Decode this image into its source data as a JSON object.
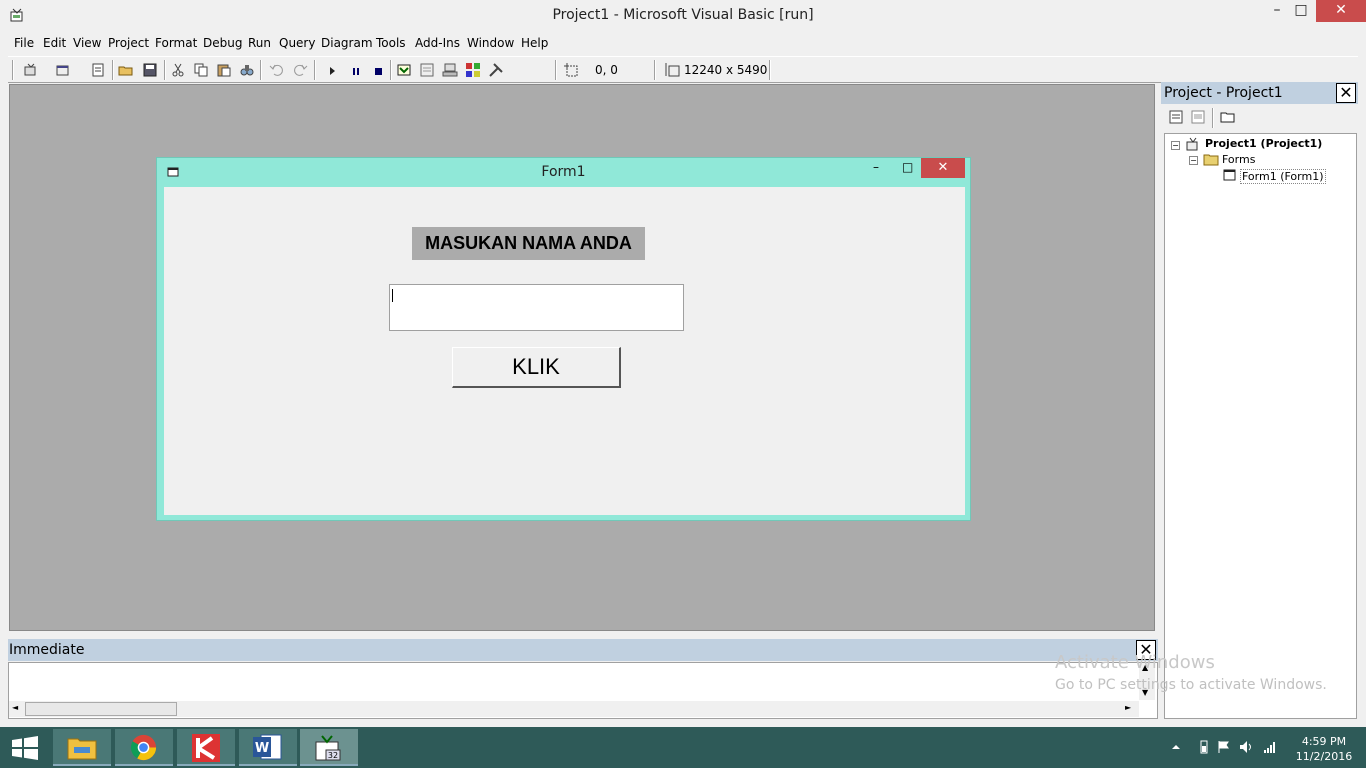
{
  "window": {
    "title": "Project1 - Microsoft Visual Basic [run]",
    "min_glyph": "–",
    "max_glyph": "□",
    "close_glyph": "✕"
  },
  "menu": [
    "File",
    "Edit",
    "View",
    "Project",
    "Format",
    "Debug",
    "Run",
    "Query",
    "Diagram",
    "Tools",
    "Add-Ins",
    "Window",
    "Help"
  ],
  "toolbar": {
    "coord": "0, 0",
    "size": "12240 x 5490",
    "icons": [
      "add-project-icon",
      "add-form-icon",
      "menu-editor-icon",
      "open-icon",
      "save-icon",
      "cut-icon",
      "copy-icon",
      "paste-icon",
      "find-icon",
      "undo-icon",
      "redo-icon",
      "start-icon",
      "break-icon",
      "end-icon",
      "project-explorer-icon",
      "properties-icon",
      "form-layout-icon",
      "object-browser-icon",
      "toolbox-icon"
    ]
  },
  "form1": {
    "title": "Form1",
    "label": "MASUKAN NAMA ANDA",
    "textbox_value": "",
    "button": "KLIK",
    "min_glyph": "–",
    "max_glyph": "□",
    "close_glyph": "✕"
  },
  "project_panel": {
    "title": "Project - Project1",
    "close_glyph": "✕",
    "tree": {
      "root": "Project1 (Project1)",
      "folder": "Forms",
      "form": "Form1 (Form1)",
      "expander": "−"
    }
  },
  "immediate": {
    "title": "Immediate",
    "close_glyph": "✕",
    "up": "▲",
    "down": "▼",
    "left": "◄",
    "right": "►"
  },
  "watermark": {
    "line1": "Activate Windows",
    "line2": "Go to PC settings to activate Windows."
  },
  "taskbar": {
    "time": "4:59 PM",
    "date": "11/2/2016",
    "apps": [
      "file-explorer-icon",
      "chrome-icon",
      "kaspersky-icon",
      "word-icon",
      "vb6-icon"
    ]
  },
  "colors": {
    "form_frame": "#90e8d8",
    "close_red": "#c94c4c",
    "mdi_bg": "#ababab",
    "panel_header": "#c0d0e0",
    "taskbar": "#2e5a58"
  }
}
